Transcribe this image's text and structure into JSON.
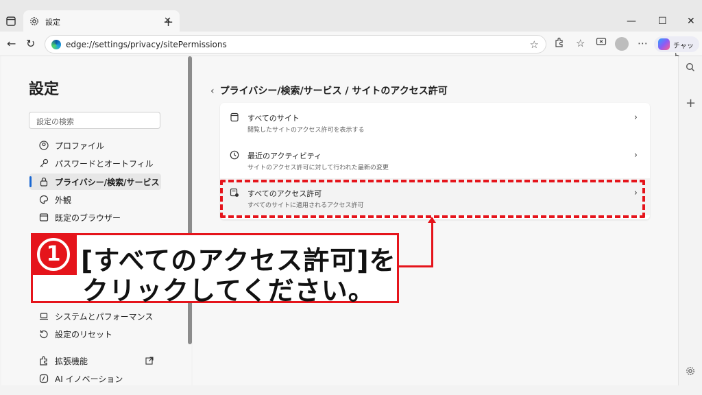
{
  "browser": {
    "tab_title": "設定",
    "url": "edge://settings/privacy/sitePermissions",
    "copilot_label": "チャット",
    "window_buttons": [
      "—",
      "☐",
      "✕"
    ]
  },
  "sidebar": {
    "title": "設定",
    "search_placeholder": "設定の検索",
    "items": [
      {
        "label": "プロファイル",
        "icon": "profile-icon"
      },
      {
        "label": "パスワードとオートフィル",
        "icon": "key-icon"
      },
      {
        "label": "プライバシー/検索/サービス",
        "icon": "lock-icon",
        "active": true
      },
      {
        "label": "外観",
        "icon": "palette-icon"
      },
      {
        "label": "既定のブラウザー",
        "icon": "browser-icon"
      },
      {
        "label": "システムとパフォーマンス",
        "icon": "laptop-icon"
      },
      {
        "label": "設定のリセット",
        "icon": "reset-icon"
      },
      {
        "label": "拡張機能",
        "icon": "puzzle-icon"
      },
      {
        "label": "AI イノベーション",
        "icon": "ai-icon"
      }
    ]
  },
  "main": {
    "breadcrumb": "プライバシー/検索/サービス  /  サイトのアクセス許可",
    "rows": [
      {
        "title": "すべてのサイト",
        "subtitle": "閲覧したサイトのアクセス許可を表示する",
        "icon": "page-icon"
      },
      {
        "title": "最近のアクティビティ",
        "subtitle": "サイトのアクセス許可に対して行われた最新の変更",
        "icon": "clock-icon"
      },
      {
        "title": "すべてのアクセス許可",
        "subtitle": "すべてのサイトに適用されるアクセス許可",
        "icon": "permissions-icon"
      }
    ]
  },
  "annotation": {
    "step_number": "1",
    "line1": "[すべてのアクセス許可]を",
    "line2": "クリックしてください。",
    "accent_color": "#e5141b"
  }
}
